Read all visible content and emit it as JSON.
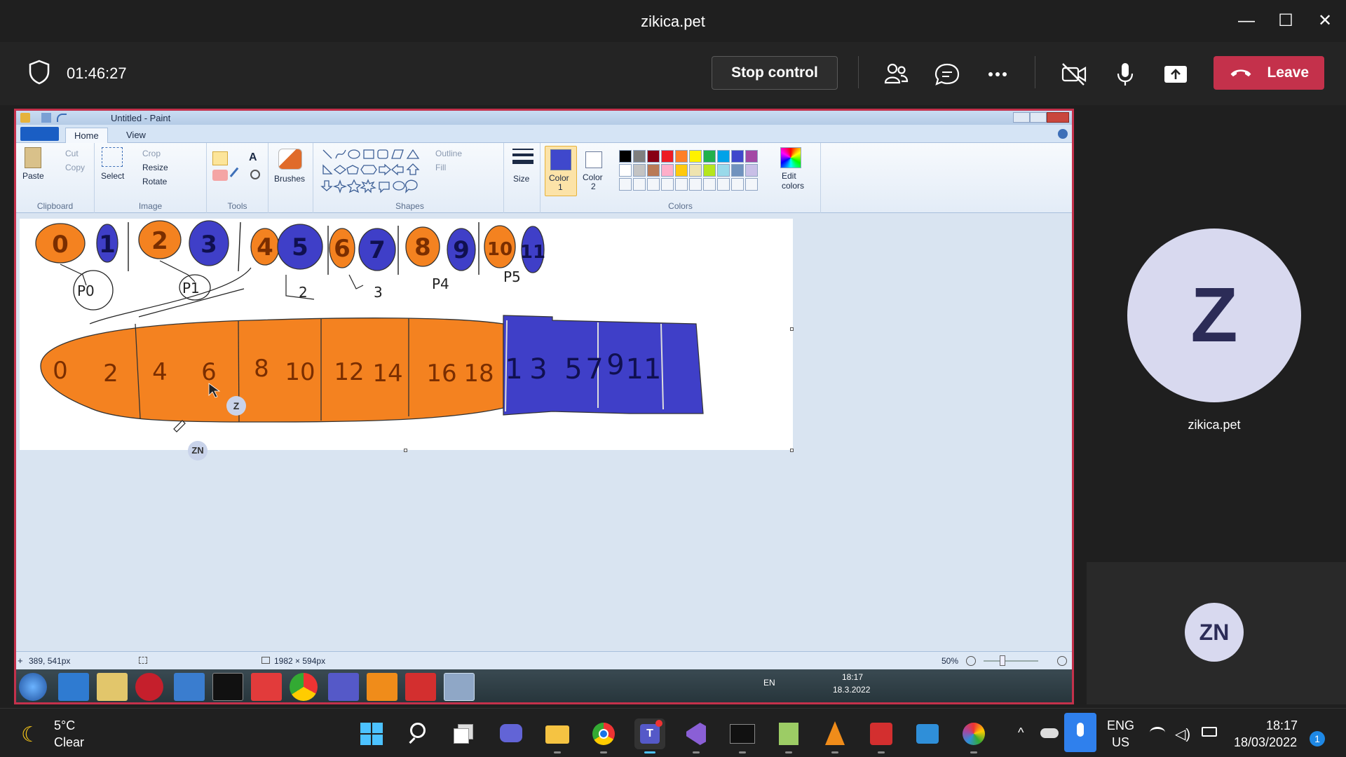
{
  "window": {
    "title": "zikica.pet",
    "minimize": "—",
    "maximize": "☐",
    "close": "✕"
  },
  "meeting": {
    "timer": "01:46:27",
    "stop_control_label": "Stop control",
    "leave_label": "Leave"
  },
  "paint": {
    "title": "Untitled - Paint",
    "tabs": [
      "Home",
      "View"
    ],
    "ribbon": {
      "paste": "Paste",
      "cut": "Cut",
      "copy": "Copy",
      "clipboard": "Clipboard",
      "select": "Select",
      "crop": "Crop",
      "resize": "Resize",
      "rotate": "Rotate",
      "image": "Image",
      "tools": "Tools",
      "brushes": "Brushes",
      "shapes": "Shapes",
      "outline": "Outline",
      "fill": "Fill",
      "size": "Size",
      "color1": "Color",
      "color1_num": "1",
      "color2": "Color",
      "color2_num": "2",
      "colors": "Colors",
      "edit_colors": "Edit colors"
    },
    "palette": [
      "#000000",
      "#7f7f7f",
      "#880015",
      "#ed1c24",
      "#ff7f27",
      "#fff200",
      "#22b14c",
      "#00a2e8",
      "#3f48cc",
      "#a349a4",
      "#ffffff",
      "#c3c3c3",
      "#b97a57",
      "#ffaec9",
      "#ffc90e",
      "#efe4b0",
      "#b5e61d",
      "#99d9ea",
      "#7092be",
      "#c8bfe7"
    ],
    "color1_value": "#3f48cc",
    "status": {
      "cursor_pos": "389, 541px",
      "canvas_size": "1982 × 594px",
      "zoom": "50%"
    },
    "remote_taskbar": {
      "lang": "EN",
      "time": "18:17",
      "date": "18.3.2022"
    },
    "drawing": {
      "top_digits": [
        "0",
        "1",
        "2",
        "3",
        "4",
        "5",
        "6",
        "7",
        "8",
        "9",
        "10",
        "11"
      ],
      "labels": [
        "P0",
        "P1",
        "2",
        "3",
        "P4",
        "P5"
      ],
      "orange_numbers": [
        "0",
        "2",
        "4",
        "6",
        "8",
        "10",
        "12",
        "14",
        "16",
        "18"
      ],
      "blue_numbers": [
        "1",
        "3",
        "5",
        "7",
        "9",
        "11"
      ]
    }
  },
  "cursor_badges": {
    "presenter": "Z",
    "self": "ZN"
  },
  "participants": {
    "remote": {
      "initial": "Z",
      "name": "zikica.pet"
    },
    "self": {
      "initials": "ZN"
    }
  },
  "taskbar": {
    "weather_temp": "5°C",
    "weather_cond": "Clear",
    "lang_1": "ENG",
    "lang_2": "US",
    "time": "18:17",
    "date": "18/03/2022",
    "notifications": "1"
  }
}
